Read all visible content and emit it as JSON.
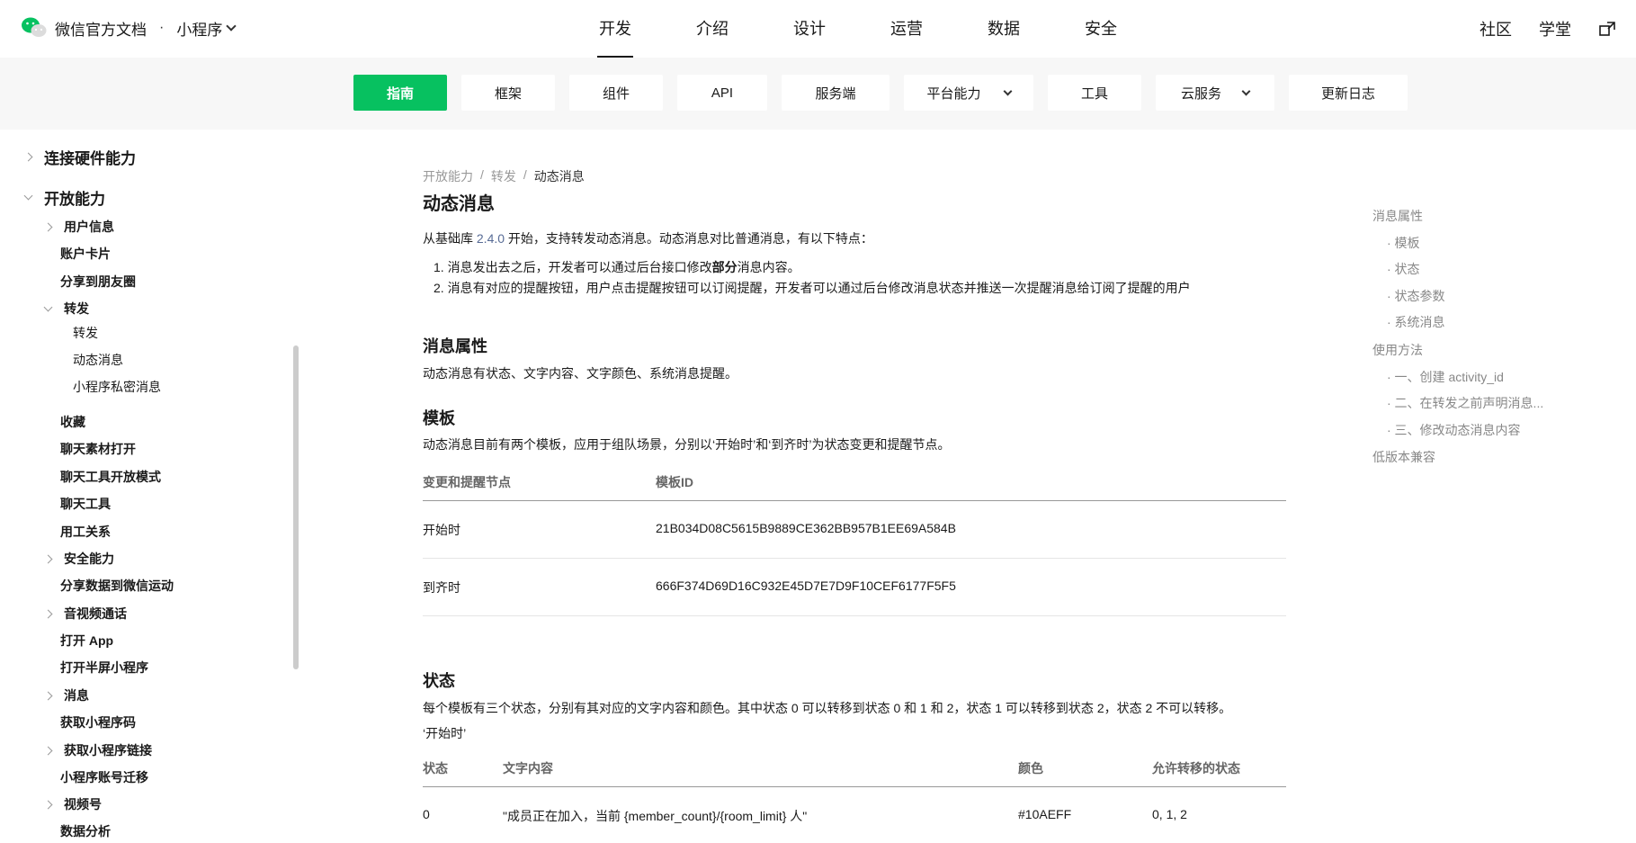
{
  "brand": {
    "title": "微信官方文档",
    "separator": "·",
    "section": "小程序"
  },
  "main_tabs": [
    "开发",
    "介绍",
    "设计",
    "运营",
    "数据",
    "安全"
  ],
  "top_right": {
    "community": "社区",
    "academy": "学堂"
  },
  "sub_tabs": [
    "指南",
    "框架",
    "组件",
    "API",
    "服务端",
    "平台能力",
    "工具",
    "云服务",
    "更新日志"
  ],
  "sidebar": {
    "items": [
      "连接硬件能力",
      "开放能力",
      "用户信息",
      "账户卡片",
      "分享到朋友圈",
      "转发",
      "转发",
      "动态消息",
      "小程序私密消息",
      "收藏",
      "聊天素材打开",
      "聊天工具开放模式",
      "聊天工具",
      "用工关系",
      "安全能力",
      "分享数据到微信运动",
      "音视频通话",
      "打开 App",
      "打开半屏小程序",
      "消息",
      "获取小程序码",
      "获取小程序链接",
      "小程序账号迁移",
      "视频号",
      "数据分析"
    ]
  },
  "breadcrumb": [
    "开放能力",
    "/",
    "转发",
    "/",
    "动态消息"
  ],
  "page_title": "动态消息",
  "intro": {
    "pre": "从基础库 ",
    "version": "2.4.0",
    "post": " 开始，支持转发动态消息。动态消息对比普通消息，有以下特点："
  },
  "features": [
    {
      "num": "1.",
      "pre": "消息发出去之后，开发者可以通过后台接口修改",
      "bold": "部分",
      "post": "消息内容。"
    },
    {
      "num": "2.",
      "text": "消息有对应的提醒按钮，用户点击提醒按钮可以订阅提醒，开发者可以通过后台修改消息状态并推送一次提醒消息给订阅了提醒的用户"
    }
  ],
  "section_props": {
    "title": "消息属性",
    "desc": "动态消息有状态、文字内容、文字颜色、系统消息提醒。"
  },
  "section_template": {
    "title": "模板",
    "desc": "动态消息目前有两个模板，应用于组队场景，分别以‘开始时’和‘到齐时’为状态变更和提醒节点。",
    "headers": [
      "变更和提醒节点",
      "模板ID"
    ],
    "rows": [
      [
        "开始时",
        "21B034D08C5615B9889CE362BB957B1EE69A584B"
      ],
      [
        "到齐时",
        "666F374D69D16C932E45D7E7D9F10CEF6177F5F5"
      ]
    ]
  },
  "section_status": {
    "title": "状态",
    "desc": "每个模板有三个状态，分别有其对应的文字内容和颜色。其中状态 0 可以转移到状态 0 和 1 和 2，状态 1 可以转移到状态 2，状态 2 不可以转移。",
    "sub": "‘开始时’",
    "headers": [
      "状态",
      "文字内容",
      "颜色",
      "允许转移的状态"
    ],
    "rows": [
      [
        "0",
        "\"成员正在加入，当前 {member_count}/{room_limit} 人\"",
        "#10AEFF",
        "0, 1, 2"
      ]
    ]
  },
  "toc": [
    "消息属性",
    "· 模板",
    "· 状态",
    "· 状态参数",
    "· 系统消息",
    "使用方法",
    "· 一、创建 activity_id",
    "· 二、在转发之前声明消息...",
    "· 三、修改动态消息内容",
    "低版本兼容"
  ],
  "colors": {
    "accent": "#07c160",
    "link": "#576b95"
  }
}
